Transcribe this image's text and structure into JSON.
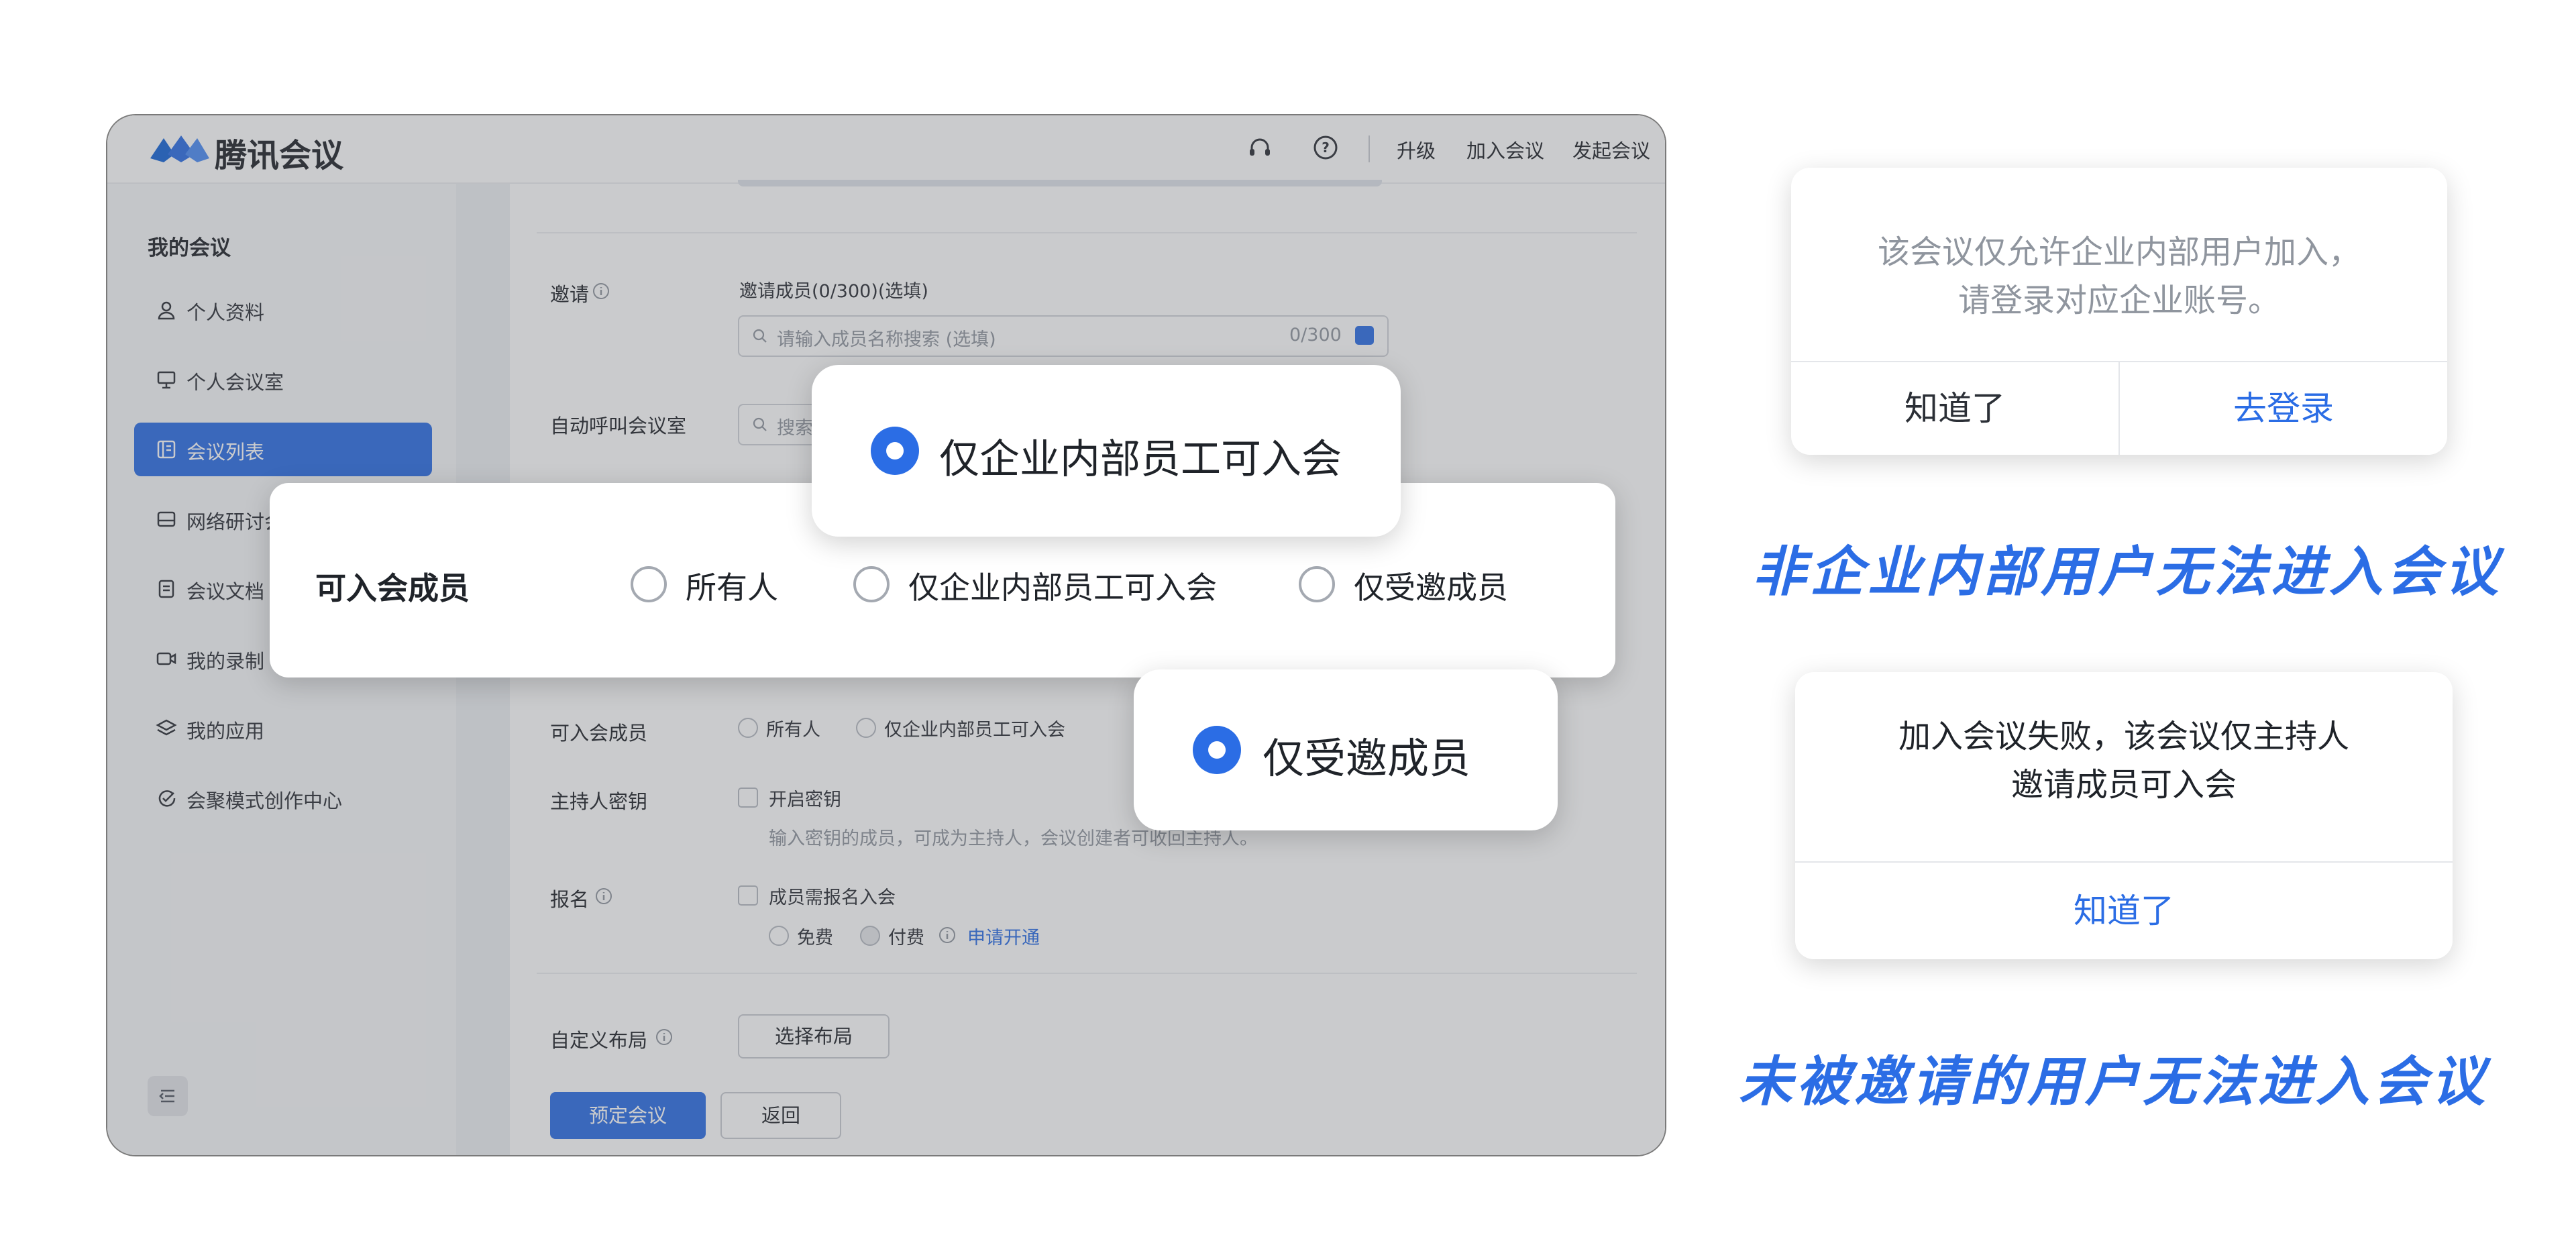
{
  "app": {
    "brand": "腾讯会议",
    "top_links": [
      "升级",
      "加入会议",
      "发起会议"
    ],
    "icons": [
      "headset-icon",
      "help-icon"
    ]
  },
  "sidebar": {
    "title": "我的会议",
    "items": [
      {
        "label": "个人资料",
        "icon": "user-icon"
      },
      {
        "label": "个人会议室",
        "icon": "room-icon"
      },
      {
        "label": "会议列表",
        "icon": "list-icon",
        "active": true
      },
      {
        "label": "网络研讨会",
        "icon": "webinar-icon"
      },
      {
        "label": "会议文档",
        "icon": "document-icon"
      },
      {
        "label": "我的录制",
        "icon": "recording-icon"
      },
      {
        "label": "我的应用",
        "icon": "apps-icon"
      },
      {
        "label": "会聚模式创作中心",
        "icon": "creation-center-icon"
      }
    ]
  },
  "form": {
    "invite_label": "邀请",
    "invite_sub": "邀请成员(0/300)(选填)",
    "invite_placeholder": "请输入成员名称搜索 (选填)",
    "invite_count": "0/300",
    "autocall_label": "自动呼叫会议室",
    "autocall_placeholder": "搜索",
    "members_label": "可入会成员",
    "member_options": [
      "所有人",
      "仅企业内部员工可入会"
    ],
    "host_key_label": "主持人密钥",
    "host_key_checkbox": "开启密钥",
    "host_key_hint": "输入密钥的成员，可成为主持人，会议创建者可收回主持人。",
    "signup_label": "报名",
    "signup_checkbox": "成员需报名入会",
    "signup_free": "免费",
    "signup_paid": "付费",
    "signup_apply_link": "申请开通",
    "layout_label": "自定义布局",
    "layout_button": "选择布局",
    "submit_button": "预定会议",
    "back_button": "返回"
  },
  "overlay": {
    "label": "可入会成员",
    "options": [
      "所有人",
      "仅企业内部员工可入会",
      "仅受邀成员"
    ],
    "callout_internal": "仅企业内部员工可入会",
    "callout_invited": "仅受邀成员"
  },
  "dialogs": [
    {
      "message_lines": [
        "该会议仅允许企业内部用户加入，",
        "请登录对应企业账号。"
      ],
      "buttons": [
        "知道了",
        "去登录"
      ],
      "caption": "非企业内部用户无法进入会议"
    },
    {
      "message_lines": [
        "加入会议失败，该会议仅主持人",
        "邀请成员可入会"
      ],
      "buttons": [
        "知道了"
      ],
      "caption": "未被邀请的用户无法进入会议"
    }
  ],
  "colors": {
    "accent": "#2b6de5",
    "dialog_text": "#8f959e",
    "dark_text": "#1f2329"
  }
}
